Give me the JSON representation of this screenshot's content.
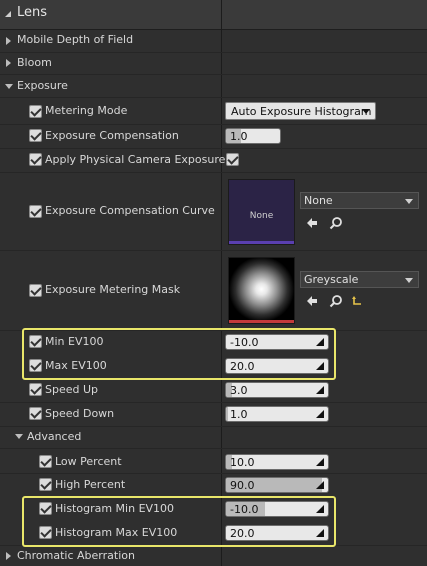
{
  "header": {
    "title": "Lens"
  },
  "categories": {
    "mobile_dof": "Mobile Depth of Field",
    "bloom": "Bloom",
    "exposure": "Exposure",
    "advanced": "Advanced",
    "chromatic": "Chromatic Aberration"
  },
  "props": {
    "metering_mode": {
      "label": "Metering Mode",
      "value": "Auto Exposure Histogram"
    },
    "exposure_comp": {
      "label": "Exposure Compensation",
      "value": "1.0",
      "fill": 0.28
    },
    "apply_phys": {
      "label": "Apply Physical Camera Exposure"
    },
    "exposure_curve": {
      "label": "Exposure Compensation Curve",
      "thumb_text": "None",
      "asset": "None"
    },
    "metering_mask": {
      "label": "Exposure Metering Mask",
      "asset": "Greyscale"
    },
    "min_ev": {
      "label": "Min EV100",
      "value": "-10.0"
    },
    "max_ev": {
      "label": "Max EV100",
      "value": "20.0"
    },
    "speed_up": {
      "label": "Speed Up",
      "value": "3.0",
      "fill": 0.06
    },
    "speed_down": {
      "label": "Speed Down",
      "value": "1.0",
      "fill": 0.02
    },
    "low_percent": {
      "label": "Low Percent",
      "value": "10.0",
      "fill": 0.06
    },
    "high_percent": {
      "label": "High Percent",
      "value": "90.0",
      "fill": 0.94
    },
    "hist_min": {
      "label": "Histogram Min EV100",
      "value": "-10.0",
      "fill": 0.38
    },
    "hist_max": {
      "label": "Histogram Max EV100",
      "value": "20.0"
    }
  },
  "colors": {
    "highlight": "#e9e66a",
    "curve_bar": "#5a3fb0",
    "mask_bar": "#c33b3b"
  }
}
